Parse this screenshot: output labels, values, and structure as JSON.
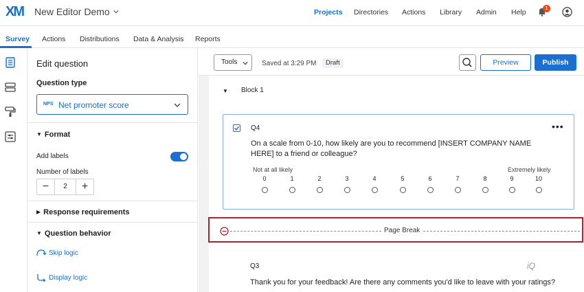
{
  "app": {
    "logo": "XM",
    "project_name": "New Editor Demo"
  },
  "topnav": {
    "items": [
      "Projects",
      "Directories",
      "Actions",
      "Library",
      "Admin",
      "Help"
    ],
    "active": "Projects",
    "notification_count": "1"
  },
  "subnav": {
    "tabs": [
      "Survey",
      "Actions",
      "Distributions",
      "Data & Analysis",
      "Reports"
    ],
    "active": "Survey"
  },
  "panel": {
    "title": "Edit question",
    "question_type_label": "Question type",
    "question_type_tag": "NPS",
    "question_type_value": "Net promoter score",
    "format_heading": "Format",
    "add_labels": "Add labels",
    "add_labels_on": true,
    "number_of_labels": "Number of labels",
    "labels_count": "2",
    "response_requirements": "Response requirements",
    "question_behavior": "Question behavior",
    "skip_logic": "Skip logic",
    "display_logic": "Display logic"
  },
  "toolbar": {
    "tools": "Tools",
    "saved": "Saved at 3:29 PM",
    "status": "Draft",
    "preview": "Preview",
    "publish": "Publish"
  },
  "block": {
    "title": "Block 1"
  },
  "q4": {
    "id": "Q4",
    "text": "On a scale from 0-10, how likely are you to recommend [INSERT COMPANY NAME HERE] to a friend or colleague?",
    "low_label": "Not at all likely",
    "high_label": "Extremely likely",
    "scale": [
      "0",
      "1",
      "2",
      "3",
      "4",
      "5",
      "6",
      "7",
      "8",
      "9",
      "10"
    ]
  },
  "page_break": {
    "label": "Page Break"
  },
  "q3": {
    "id": "Q3",
    "badge": "iQ",
    "text": "Thank you for your feedback! Are there any comments you'd like to leave with your ratings?"
  },
  "colors": {
    "accent": "#1a6fd1",
    "highlight": "#b5202e",
    "badge": "#e64a19"
  }
}
